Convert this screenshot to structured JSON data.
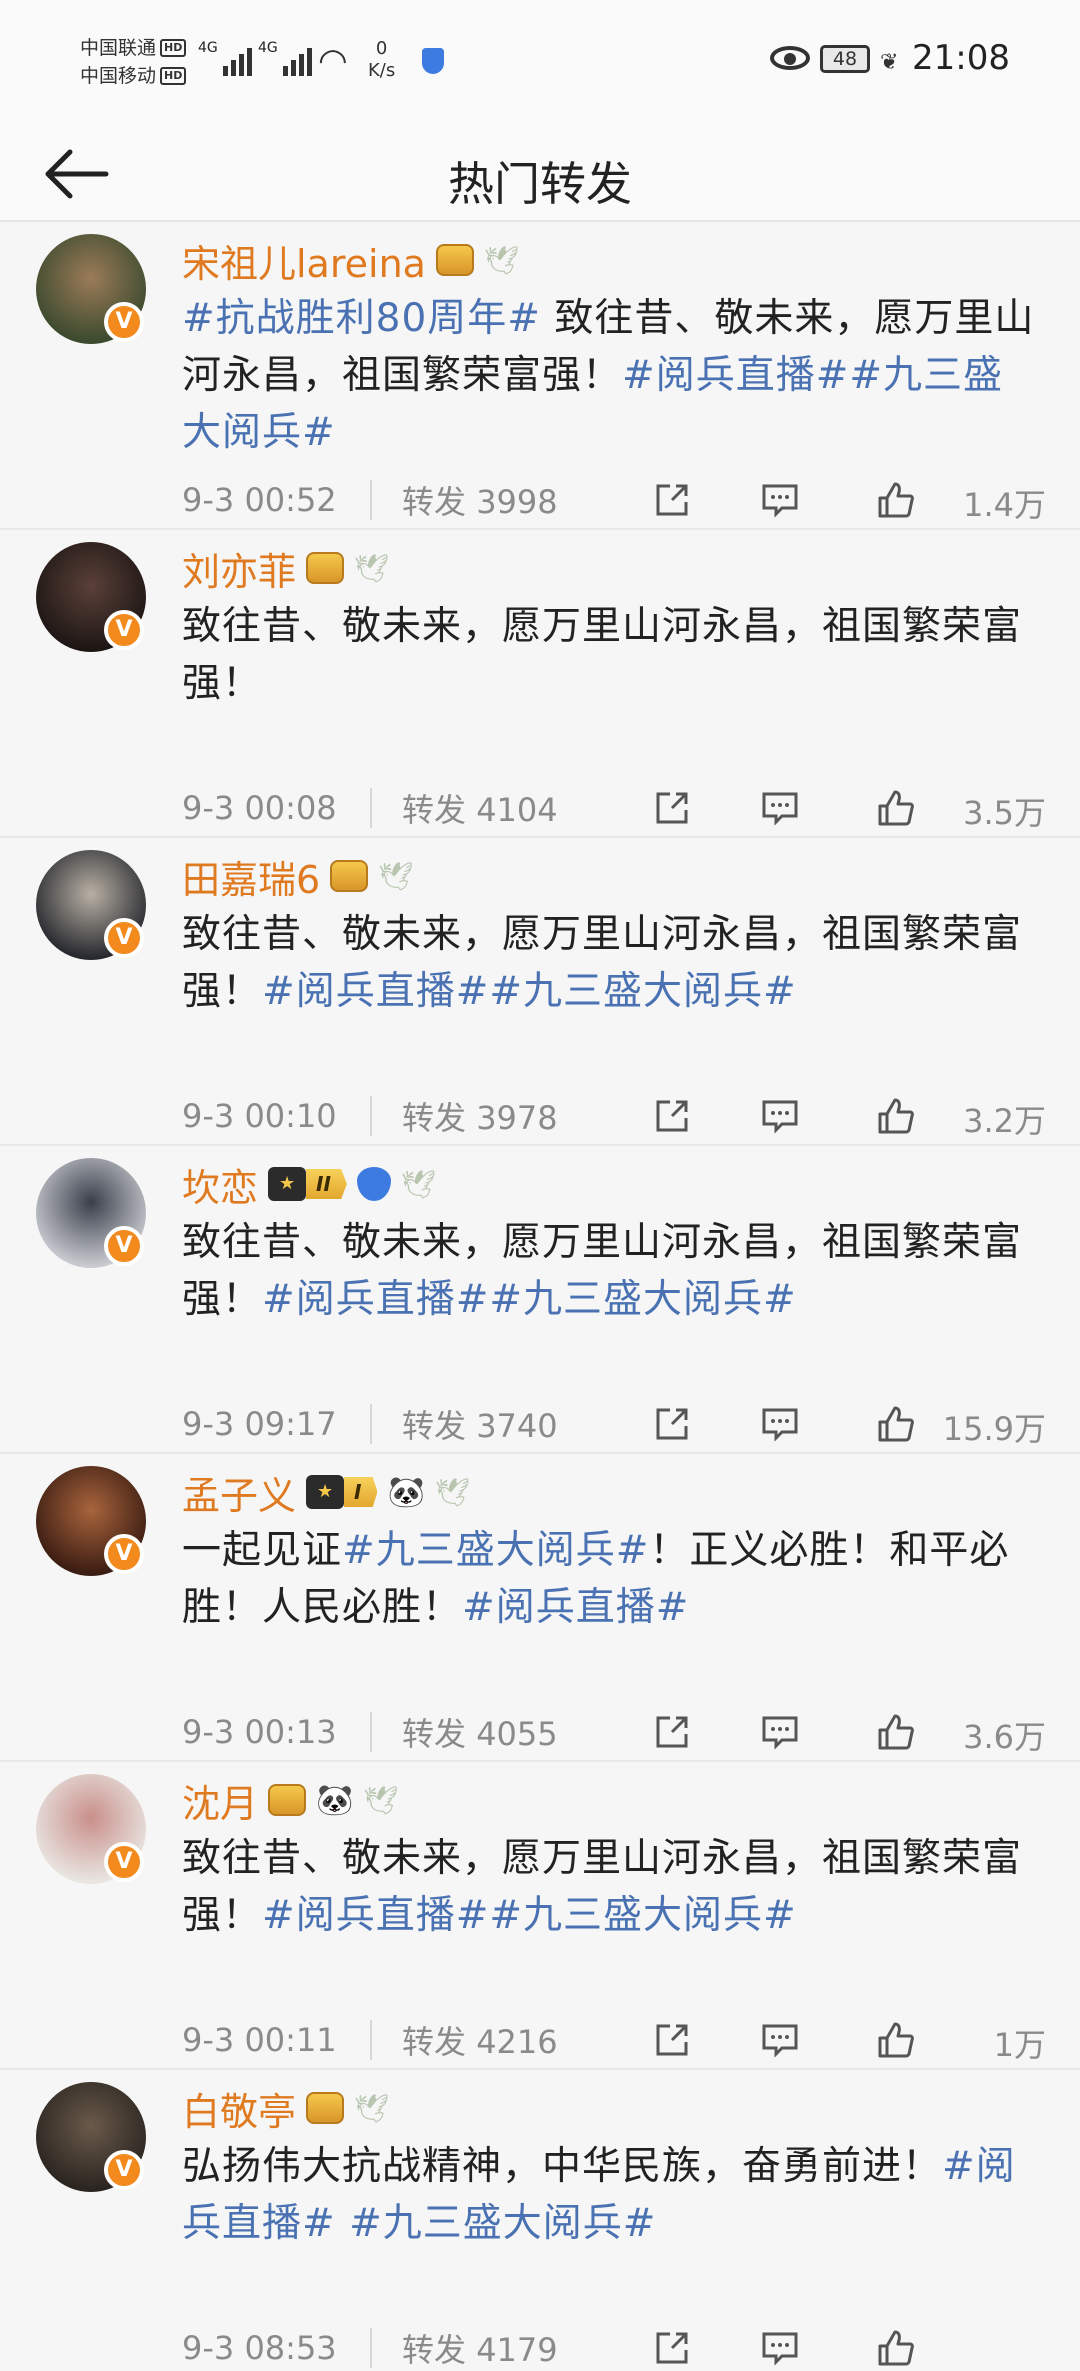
{
  "status": {
    "carrier1": "中国联通",
    "carrier2": "中国移动",
    "hd": "HD",
    "network": "4G",
    "speed_value": "0",
    "speed_unit": "K/s",
    "battery": "48",
    "time": "21:08"
  },
  "header": {
    "title": "热门转发"
  },
  "accent": {
    "name": "#e07a21",
    "topic": "#4a72b2",
    "vbadge": "#f38a1d"
  },
  "repost_label": "转发",
  "posts": [
    {
      "name": "宋祖儿lareina",
      "badges": [
        "crown",
        "dove"
      ],
      "segments": [
        {
          "t": "#抗战胜利80周年#",
          "topic": true
        },
        {
          "t": " 致往昔、敬未来，愿万里山河永昌，祖国繁荣富强！",
          "topic": false
        },
        {
          "t": "#阅兵直播#",
          "topic": true
        },
        {
          "t": "#九三盛大阅兵#",
          "topic": true
        }
      ],
      "time": "9-3 00:52",
      "reposts": "3998",
      "likes": "1.4万"
    },
    {
      "name": "刘亦菲",
      "badges": [
        "crown",
        "dove"
      ],
      "segments": [
        {
          "t": "致往昔、敬未来，愿万里山河永昌，祖国繁荣富强！",
          "topic": false
        }
      ],
      "time": "9-3 00:08",
      "reposts": "4104",
      "likes": "3.5万"
    },
    {
      "name": "田嘉瑞6",
      "badges": [
        "crown",
        "dove"
      ],
      "segments": [
        {
          "t": "致往昔、敬未来，愿万里山河永昌，祖国繁荣富强！",
          "topic": false
        },
        {
          "t": "#阅兵直播#",
          "topic": true
        },
        {
          "t": "#九三盛大阅兵#",
          "topic": true
        }
      ],
      "time": "9-3 00:10",
      "reposts": "3978",
      "likes": "3.2万"
    },
    {
      "name": "坎恋",
      "badges": [
        "rank-II",
        "diamond",
        "dove"
      ],
      "segments": [
        {
          "t": "致往昔、敬未来，愿万里山河永昌，祖国繁荣富强！",
          "topic": false
        },
        {
          "t": "#阅兵直播#",
          "topic": true
        },
        {
          "t": "#九三盛大阅兵#",
          "topic": true
        }
      ],
      "time": "9-3 09:17",
      "reposts": "3740",
      "likes": "15.9万"
    },
    {
      "name": "孟子义",
      "badges": [
        "rank-I",
        "panda",
        "dove"
      ],
      "segments": [
        {
          "t": "一起见证",
          "topic": false
        },
        {
          "t": "#九三盛大阅兵#",
          "topic": true
        },
        {
          "t": "！正义必胜！和平必胜！人民必胜！",
          "topic": false
        },
        {
          "t": "#阅兵直播#",
          "topic": true
        }
      ],
      "time": "9-3 00:13",
      "reposts": "4055",
      "likes": "3.6万"
    },
    {
      "name": "沈月",
      "badges": [
        "crown",
        "panda",
        "dove"
      ],
      "segments": [
        {
          "t": "致往昔、敬未来，愿万里山河永昌，祖国繁荣富强！",
          "topic": false
        },
        {
          "t": "#阅兵直播#",
          "topic": true
        },
        {
          "t": "#九三盛大阅兵#",
          "topic": true
        }
      ],
      "time": "9-3 00:11",
      "reposts": "4216",
      "likes": "1万"
    },
    {
      "name": "白敬亭",
      "badges": [
        "crown",
        "dove"
      ],
      "segments": [
        {
          "t": "弘扬伟大抗战精神，中华民族，奋勇前进！",
          "topic": false
        },
        {
          "t": "#阅兵直播#",
          "topic": true
        },
        {
          "t": " ",
          "topic": false
        },
        {
          "t": "#九三盛大阅兵#",
          "topic": true
        }
      ],
      "time": "9-3 08:53",
      "reposts": "4179",
      "likes": ""
    }
  ]
}
